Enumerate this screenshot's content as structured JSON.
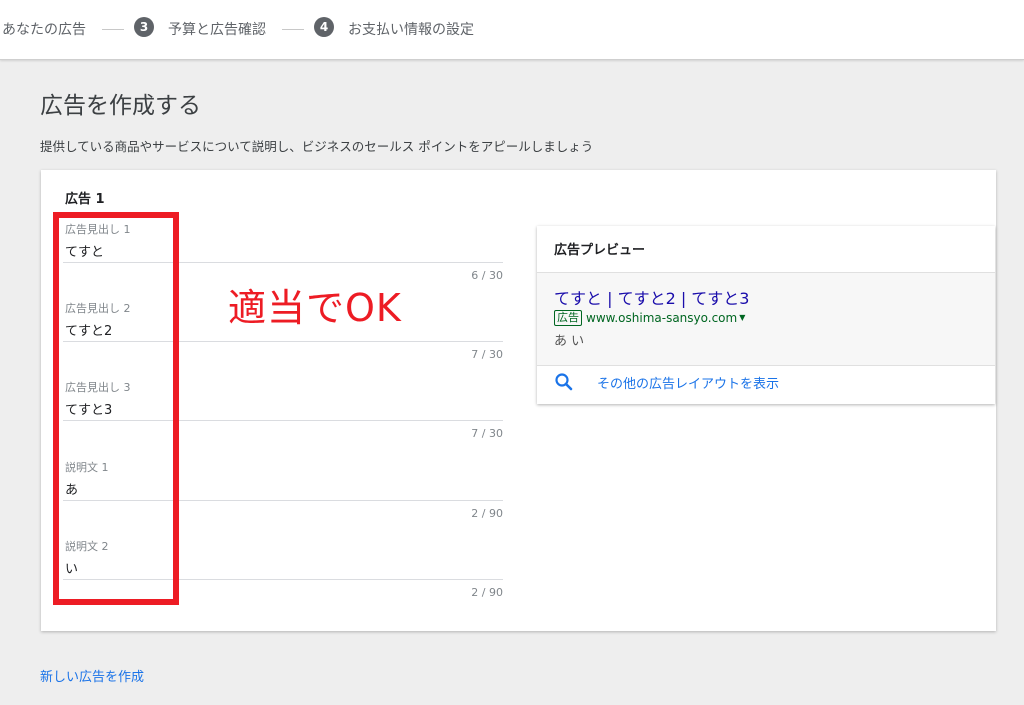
{
  "steps": {
    "step2_label": "あなたの広告",
    "step3_number": "3",
    "step3_label": "予算と広告確認",
    "step4_number": "4",
    "step4_label": "お支払い情報の設定"
  },
  "page": {
    "title": "広告を作成する",
    "description": "提供している商品やサービスについて説明し、ビジネスのセールス ポイントをアピールしましょう"
  },
  "ad": {
    "title": "広告 1",
    "fields": [
      {
        "label": "広告見出し 1",
        "value": "てすと",
        "count": "6 / 30"
      },
      {
        "label": "広告見出し 2",
        "value": "てすと2",
        "count": "7 / 30"
      },
      {
        "label": "広告見出し 3",
        "value": "てすと3",
        "count": "7 / 30"
      },
      {
        "label": "説明文 1",
        "value": "あ",
        "count": "2 / 90"
      },
      {
        "label": "説明文 2",
        "value": "い",
        "count": "2 / 90"
      }
    ]
  },
  "annotation": {
    "text": "適当でOK",
    "color": "#ed1c24"
  },
  "preview": {
    "title": "広告プレビュー",
    "headline": "てすと | てすと2 | てすと3",
    "badge": "広告",
    "url": "www.oshima-sansyo.com",
    "description": "あ い",
    "more_layouts": "その他の広告レイアウトを表示",
    "search_icon": "search-icon"
  },
  "footer": {
    "new_ad_link": "新しい広告を作成"
  },
  "colors": {
    "accent": "#1a73e8",
    "headline_link": "#1a0dab",
    "url_green": "#006621"
  }
}
